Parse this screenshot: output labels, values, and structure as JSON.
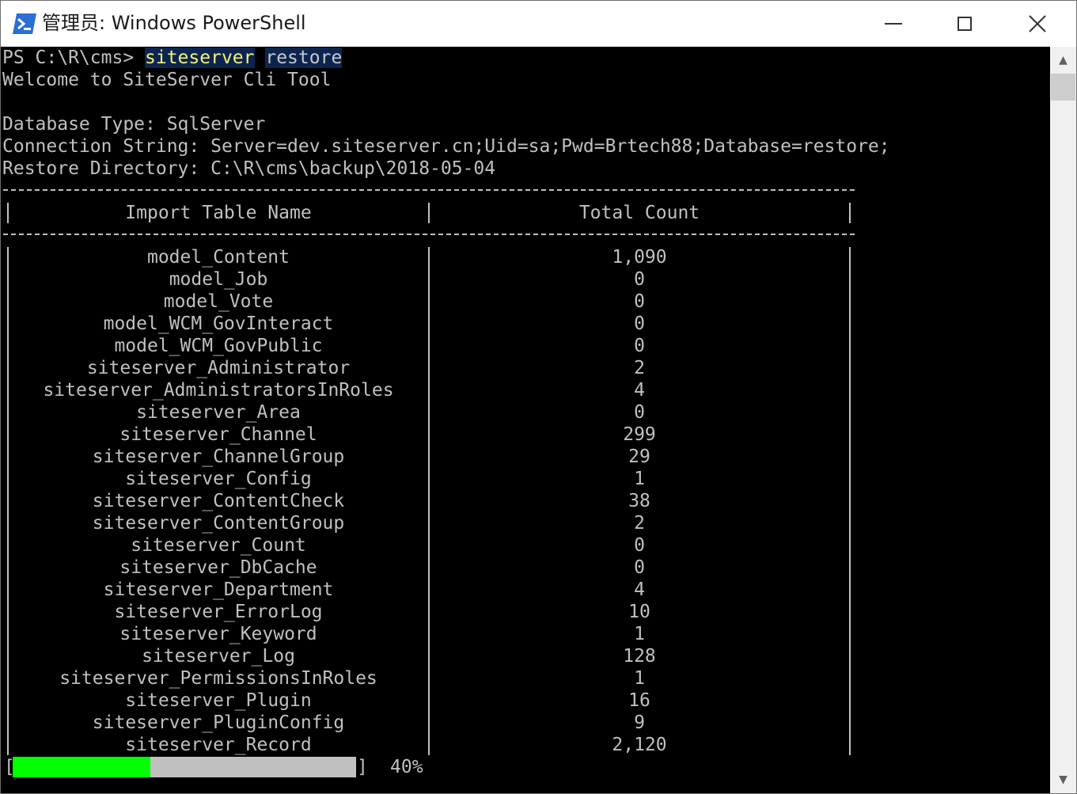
{
  "window": {
    "title": "管理员: Windows PowerShell",
    "controls": {
      "minimize": "minimize",
      "maximize": "maximize",
      "close": "close"
    }
  },
  "console": {
    "prompt": "PS C:\\R\\cms> ",
    "command": "siteserver",
    "argument": "restore",
    "welcome": "Welcome to SiteServer Cli Tool",
    "db_type": "Database Type: SqlServer",
    "connection": "Connection String: Server=dev.siteserver.cn;Uid=sa;Pwd=Brtech88;Database=restore;",
    "restore_dir": "Restore Directory: C:\\R\\cms\\backup\\2018-05-04"
  },
  "table": {
    "headers": [
      "Import Table Name",
      "Total Count"
    ],
    "rows": [
      [
        "model_Content",
        "1,090"
      ],
      [
        "model_Job",
        "0"
      ],
      [
        "model_Vote",
        "0"
      ],
      [
        "model_WCM_GovInteract",
        "0"
      ],
      [
        "model_WCM_GovPublic",
        "0"
      ],
      [
        "siteserver_Administrator",
        "2"
      ],
      [
        "siteserver_AdministratorsInRoles",
        "4"
      ],
      [
        "siteserver_Area",
        "0"
      ],
      [
        "siteserver_Channel",
        "299"
      ],
      [
        "siteserver_ChannelGroup",
        "29"
      ],
      [
        "siteserver_Config",
        "1"
      ],
      [
        "siteserver_ContentCheck",
        "38"
      ],
      [
        "siteserver_ContentGroup",
        "2"
      ],
      [
        "siteserver_Count",
        "0"
      ],
      [
        "siteserver_DbCache",
        "0"
      ],
      [
        "siteserver_Department",
        "4"
      ],
      [
        "siteserver_ErrorLog",
        "10"
      ],
      [
        "siteserver_Keyword",
        "1"
      ],
      [
        "siteserver_Log",
        "128"
      ],
      [
        "siteserver_PermissionsInRoles",
        "1"
      ],
      [
        "siteserver_Plugin",
        "16"
      ],
      [
        "siteserver_PluginConfig",
        "9"
      ],
      [
        "siteserver_Record",
        "2,120"
      ]
    ]
  },
  "progress": {
    "fraction": 0.4,
    "label": "40%",
    "bracket_open": "[",
    "bracket_close": "]",
    "fill_color": "#00ff00",
    "track_color": "#c0c0c0"
  },
  "scrollbar": {
    "up_icon": "▲",
    "down_icon": "▼"
  },
  "colors": {
    "console_bg": "#000000",
    "console_fg": "#c0c0c0",
    "highlight_bg": "#0c2550",
    "command_fg": "#f5f276"
  }
}
